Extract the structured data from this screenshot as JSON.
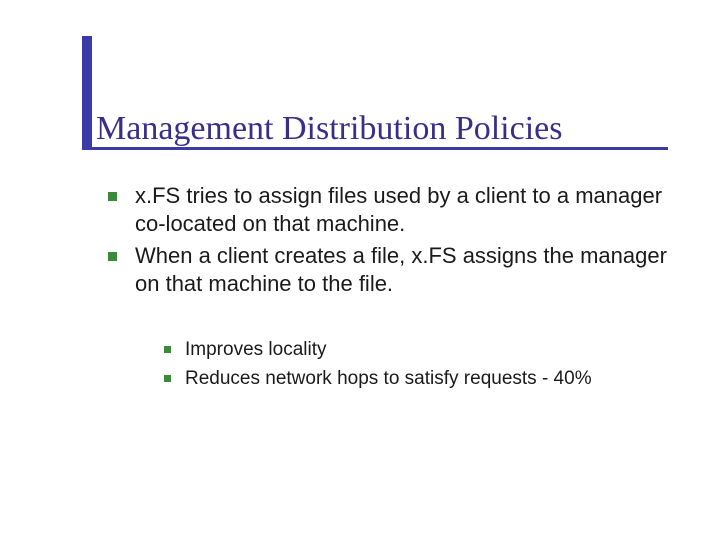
{
  "title": "Management Distribution Policies",
  "bullets": [
    "x.FS tries to assign files used by a client to a manager co-located on that machine.",
    "When a client creates a file, x.FS assigns the manager on that machine to the file."
  ],
  "subbullets": [
    "Improves locality",
    "Reduces network hops to satisfy requests - 40%"
  ],
  "colors": {
    "title": "#392f8a",
    "accent": "#3b3ba8",
    "bullet": "#3b8a3b"
  }
}
